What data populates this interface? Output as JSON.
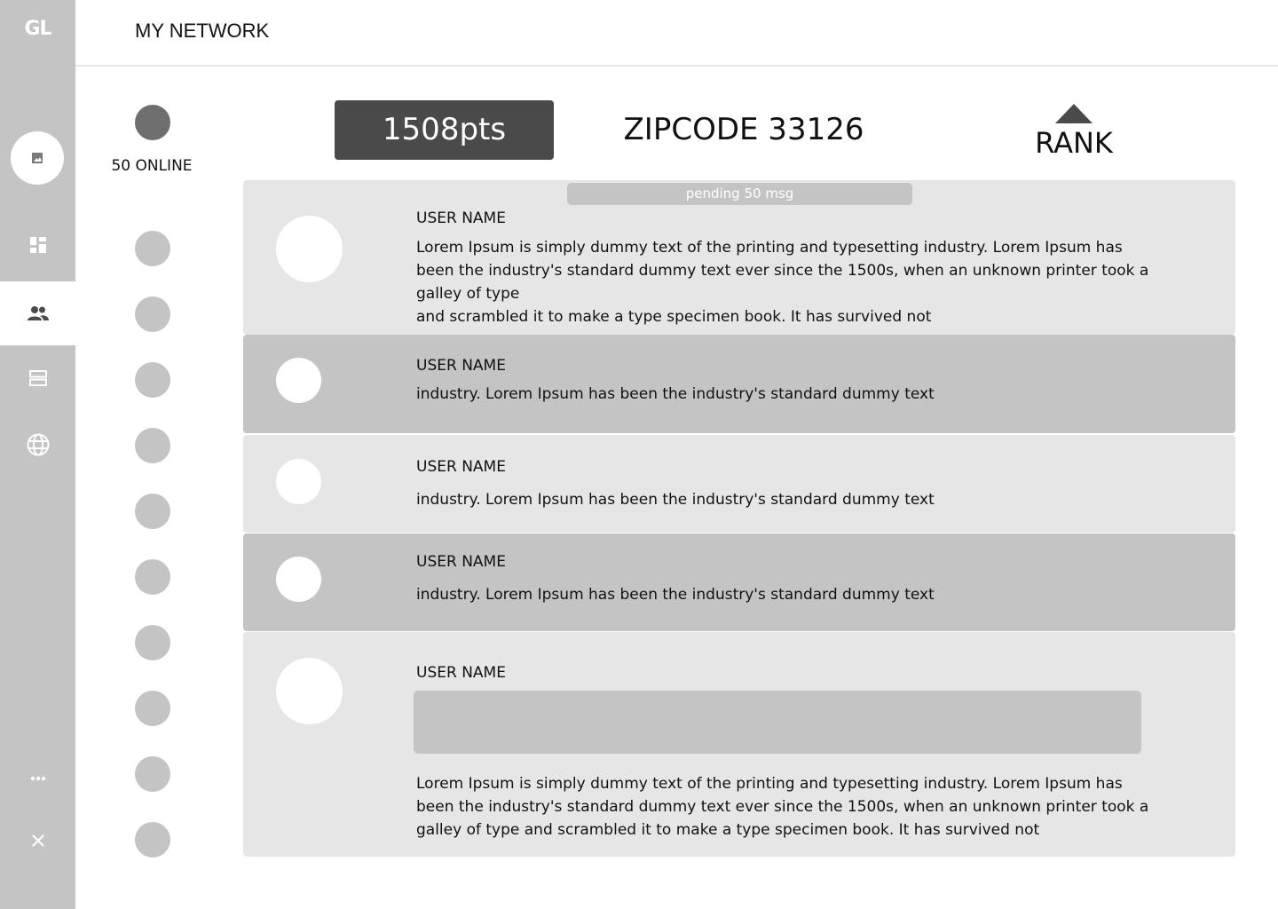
{
  "sidebar": {
    "logo": "GL",
    "items": [
      {
        "icon": "image-icon"
      },
      {
        "icon": "dashboard-icon"
      },
      {
        "icon": "people-icon",
        "active": true
      },
      {
        "icon": "storage-icon"
      },
      {
        "icon": "globe-icon"
      },
      {
        "icon": "more-icon"
      },
      {
        "icon": "close-icon"
      }
    ]
  },
  "header": {
    "title": "MY NETWORK"
  },
  "online": {
    "label": "50 ONLINE"
  },
  "stats": {
    "points": "1508pts",
    "zipcode": "ZIPCODE 33126",
    "rank_label": "RANK"
  },
  "pending": {
    "label": "pending 50 msg"
  },
  "messages": [
    {
      "user": "USER NAME",
      "lines": [
        "Lorem Ipsum is simply dummy text of the printing and typesetting  industry. Lorem Ipsum has",
        "been the industry's standard dummy text ever since the 1500s, when an unknown printer took a",
        "galley of type",
        "and scrambled it to make a type specimen book. It has survived not"
      ]
    },
    {
      "user": "USER NAME",
      "lines": [
        "industry. Lorem Ipsum has been the industry's standard dummy text"
      ]
    },
    {
      "user": "USER NAME",
      "lines": [
        "industry. Lorem Ipsum has been the industry's standard dummy text"
      ]
    },
    {
      "user": "USER NAME",
      "lines": [
        "industry. Lorem Ipsum has been the industry's standard dummy text"
      ]
    },
    {
      "user": "USER NAME",
      "lines": [
        "Lorem Ipsum is simply dummy text of the printing and typesetting  industry. Lorem Ipsum has",
        "been the industry's standard dummy text ever since the 1500s, when an unknown printer took a",
        "galley of type and scrambled it to make a type specimen book. It has survived not"
      ]
    }
  ],
  "colors": {
    "sidebar": "#c4c4c4",
    "card_light": "#e6e6e6",
    "card_dark": "#c4c4c4",
    "points_bg": "#4a4a4a",
    "online_indicator": "#6e6e6e"
  }
}
